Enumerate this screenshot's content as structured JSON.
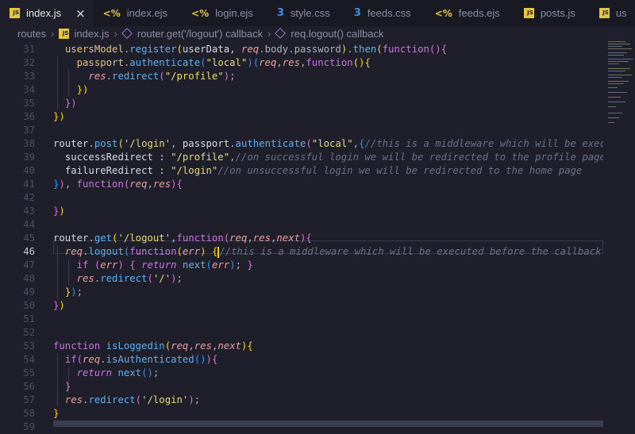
{
  "tabs": [
    {
      "label": "index.js",
      "type": "js",
      "active": true
    },
    {
      "label": "index.ejs",
      "type": "ejs"
    },
    {
      "label": "login.ejs",
      "type": "ejs"
    },
    {
      "label": "style.css",
      "type": "css"
    },
    {
      "label": "feeds.css",
      "type": "css"
    },
    {
      "label": "feeds.ejs",
      "type": "ejs"
    },
    {
      "label": "posts.js",
      "type": "js"
    },
    {
      "label": "us",
      "type": "js"
    }
  ],
  "tab_close_glyph": "×",
  "breadcrumb": [
    "routes",
    "index.js",
    "router.get('/logout') callback",
    "req.logout() callback"
  ],
  "editor": {
    "current_line": 46,
    "line_numbers": [
      31,
      32,
      33,
      34,
      35,
      36,
      37,
      38,
      39,
      40,
      41,
      42,
      43,
      44,
      45,
      46,
      47,
      48,
      49,
      50,
      51,
      52,
      53,
      54,
      55,
      56,
      57,
      58,
      59
    ]
  },
  "colors": {
    "background": "#1e1f2b",
    "cursor": "#ffcc00",
    "keyword": "#c678dd",
    "function": "#61afef",
    "string": "#e6db74",
    "comment": "#6b7089"
  }
}
